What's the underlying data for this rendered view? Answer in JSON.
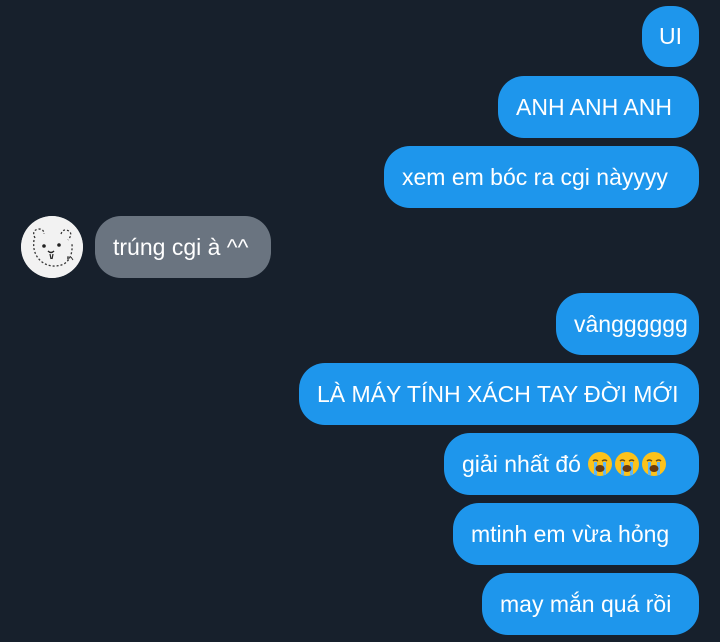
{
  "chat": {
    "messages": [
      {
        "direction": "out",
        "text": "UI"
      },
      {
        "direction": "out",
        "text": "ANH ANH ANH"
      },
      {
        "direction": "out",
        "text": "xem em bóc ra cgi nàyyyy"
      },
      {
        "direction": "in",
        "text": "trúng cgi à ^^"
      },
      {
        "direction": "out",
        "text": "vângggggg"
      },
      {
        "direction": "out",
        "text": "LÀ MÁY TÍNH XÁCH TAY ĐỜI MỚI"
      },
      {
        "direction": "out",
        "text": "giải nhất đó",
        "emojis": [
          "loudly-crying-face",
          "loudly-crying-face",
          "loudly-crying-face"
        ]
      },
      {
        "direction": "out",
        "text": "mtinh em vừa hỏng"
      },
      {
        "direction": "out",
        "text": "may mắn quá rồi"
      }
    ],
    "contact_avatar": "bear-doodle-avatar"
  },
  "colors": {
    "background": "#17202c",
    "outgoing_bubble": "#1e96ec",
    "incoming_bubble": "#6a7480",
    "text": "#ffffff"
  }
}
